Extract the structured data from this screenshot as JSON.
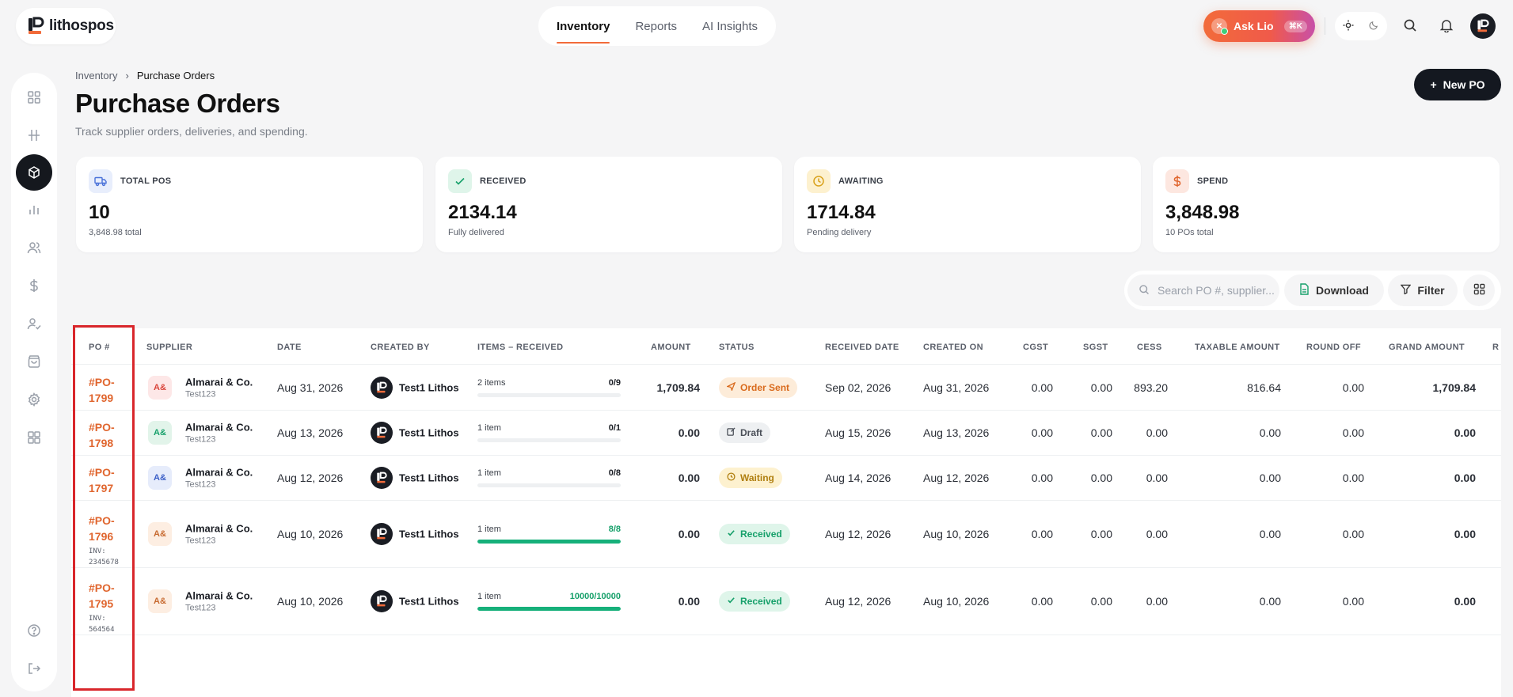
{
  "app": {
    "name": "lithospos"
  },
  "top_nav": {
    "tabs": [
      {
        "label": "Inventory",
        "active": true
      },
      {
        "label": "Reports"
      },
      {
        "label": "AI Insights"
      }
    ]
  },
  "ask_lio": {
    "label": "Ask Lio",
    "shortcut": "⌘K"
  },
  "breadcrumb": {
    "parent": "Inventory",
    "current": "Purchase Orders"
  },
  "page": {
    "title": "Purchase Orders",
    "subtitle": "Track supplier orders, deliveries, and spending.",
    "new_button": "New PO"
  },
  "stats": [
    {
      "label": "TOTAL POS",
      "value": "10",
      "note": "3,848.98 total",
      "icon": "truck-icon",
      "color": "#e8eefc",
      "icon_color": "#4a72d9"
    },
    {
      "label": "RECEIVED",
      "value": "2134.14",
      "note": "Fully delivered",
      "icon": "check-icon",
      "color": "#dff5ea",
      "icon_color": "#16a06a"
    },
    {
      "label": "AWAITING",
      "value": "1714.84",
      "note": "Pending delivery",
      "icon": "clock-icon",
      "color": "#fdf1cf",
      "icon_color": "#d9a21c"
    },
    {
      "label": "SPEND",
      "value": "3,848.98",
      "note": "10 POs total",
      "icon": "dollar-icon",
      "color": "#fde7e0",
      "icon_color": "#e0662f"
    }
  ],
  "toolbar": {
    "search_placeholder": "Search PO #, supplier...",
    "download": "Download",
    "filter": "Filter"
  },
  "table": {
    "columns": [
      "PO #",
      "SUPPLIER",
      "DATE",
      "CREATED BY",
      "ITEMS – RECEIVED",
      "AMOUNT",
      "STATUS",
      "RECEIVED DATE",
      "CREATED ON",
      "CGST",
      "SGST",
      "CESS",
      "TAXABLE AMOUNT",
      "ROUND OFF",
      "GRAND AMOUNT",
      "R"
    ],
    "rows": [
      {
        "po_line1": "#PO-",
        "po_line2": "1799",
        "inv_label": "",
        "inv_num": "",
        "sup_initials": "A&",
        "sup_color": "#fde7e7",
        "sup_text": "#d9443a",
        "supplier": "Almarai & Co.",
        "supplier_sub": "Test123",
        "date": "Aug 31, 2026",
        "created_by": "Test1 Lithos",
        "items_label": "2 items",
        "items_ratio": "0/9",
        "progress": 0,
        "ratio_color": "#1a1d24",
        "amount": "1,709.84",
        "status": "Order Sent",
        "status_icon": "send-icon",
        "status_bg": "#fdecd9",
        "status_fg": "#d96a1c",
        "received_date": "Sep 02, 2026",
        "created_on": "Aug 31, 2026",
        "cgst": "0.00",
        "sgst": "0.00",
        "cess": "893.20",
        "taxable": "816.64",
        "round_off": "0.00",
        "grand": "1,709.84"
      },
      {
        "po_line1": "#PO-",
        "po_line2": "1798",
        "inv_label": "",
        "inv_num": "",
        "sup_initials": "A&",
        "sup_color": "#e2f4ea",
        "sup_text": "#16a06a",
        "supplier": "Almarai & Co.",
        "supplier_sub": "Test123",
        "date": "Aug 13, 2026",
        "created_by": "Test1 Lithos",
        "items_label": "1 item",
        "items_ratio": "0/1",
        "progress": 0,
        "ratio_color": "#1a1d24",
        "amount": "0.00",
        "status": "Draft",
        "status_icon": "edit-icon",
        "status_bg": "#eef0f2",
        "status_fg": "#4a4f58",
        "received_date": "Aug 15, 2026",
        "created_on": "Aug 13, 2026",
        "cgst": "0.00",
        "sgst": "0.00",
        "cess": "0.00",
        "taxable": "0.00",
        "round_off": "0.00",
        "grand": "0.00"
      },
      {
        "po_line1": "#PO-",
        "po_line2": "1797",
        "inv_label": "",
        "inv_num": "",
        "sup_initials": "A&",
        "sup_color": "#e6ecfb",
        "sup_text": "#3b5fc7",
        "supplier": "Almarai & Co.",
        "supplier_sub": "Test123",
        "date": "Aug 12, 2026",
        "created_by": "Test1 Lithos",
        "items_label": "1 item",
        "items_ratio": "0/8",
        "progress": 0,
        "ratio_color": "#1a1d24",
        "amount": "0.00",
        "status": "Waiting",
        "status_icon": "clock-icon",
        "status_bg": "#fdf1cf",
        "status_fg": "#b07f10",
        "received_date": "Aug 14, 2026",
        "created_on": "Aug 12, 2026",
        "cgst": "0.00",
        "sgst": "0.00",
        "cess": "0.00",
        "taxable": "0.00",
        "round_off": "0.00",
        "grand": "0.00"
      },
      {
        "po_line1": "#PO-",
        "po_line2": "1796",
        "inv_label": "INV:",
        "inv_num": "2345678",
        "sup_initials": "A&",
        "sup_color": "#fdeee2",
        "sup_text": "#c76a30",
        "supplier": "Almarai & Co.",
        "supplier_sub": "Test123",
        "date": "Aug 10, 2026",
        "created_by": "Test1 Lithos",
        "items_label": "1 item",
        "items_ratio": "8/8",
        "progress": 1,
        "ratio_color": "#16a06a",
        "amount": "0.00",
        "status": "Received",
        "status_icon": "check-icon",
        "status_bg": "#dff5ea",
        "status_fg": "#16a06a",
        "received_date": "Aug 12, 2026",
        "created_on": "Aug 10, 2026",
        "cgst": "0.00",
        "sgst": "0.00",
        "cess": "0.00",
        "taxable": "0.00",
        "round_off": "0.00",
        "grand": "0.00"
      },
      {
        "po_line1": "#PO-",
        "po_line2": "1795",
        "inv_label": "INV:",
        "inv_num": "564564",
        "sup_initials": "A&",
        "sup_color": "#fdeee2",
        "sup_text": "#c76a30",
        "supplier": "Almarai & Co.",
        "supplier_sub": "Test123",
        "date": "Aug 10, 2026",
        "created_by": "Test1 Lithos",
        "items_label": "1 item",
        "items_ratio": "10000/10000",
        "progress": 1,
        "ratio_color": "#16a06a",
        "amount": "0.00",
        "status": "Received",
        "status_icon": "check-icon",
        "status_bg": "#dff5ea",
        "status_fg": "#16a06a",
        "received_date": "Aug 12, 2026",
        "created_on": "Aug 10, 2026",
        "cgst": "0.00",
        "sgst": "0.00",
        "cess": "0.00",
        "taxable": "0.00",
        "round_off": "0.00",
        "grand": "0.00"
      }
    ]
  },
  "sidebar": {
    "items": [
      "dashboard-icon",
      "terminal-icon",
      "inventory-icon",
      "reports-icon",
      "customers-icon",
      "dollar-icon",
      "staff-icon",
      "bag-icon",
      "settings-icon",
      "apps-icon",
      "help-icon",
      "logout-icon"
    ]
  }
}
